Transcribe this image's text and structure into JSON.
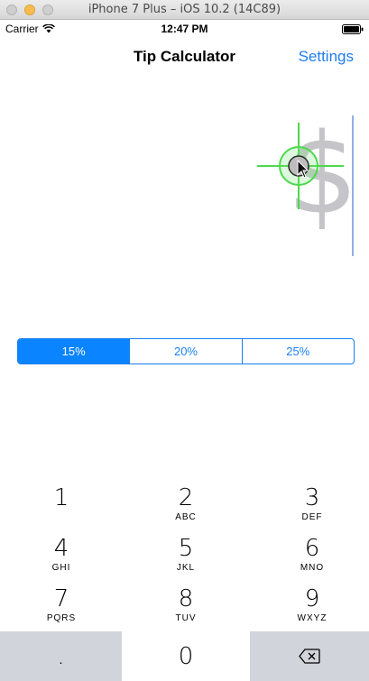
{
  "window": {
    "title": "iPhone 7 Plus – iOS 10.2 (14C89)"
  },
  "status_bar": {
    "carrier": "Carrier",
    "time": "12:47 PM"
  },
  "nav": {
    "title": "Tip Calculator",
    "settings_label": "Settings"
  },
  "bill": {
    "placeholder": "$"
  },
  "tip_segments": [
    {
      "label": "15%",
      "selected": true
    },
    {
      "label": "20%",
      "selected": false
    },
    {
      "label": "25%",
      "selected": false
    }
  ],
  "keypad": {
    "keys": [
      {
        "digit": "1",
        "letters": ""
      },
      {
        "digit": "2",
        "letters": "ABC"
      },
      {
        "digit": "3",
        "letters": "DEF"
      },
      {
        "digit": "4",
        "letters": "GHI"
      },
      {
        "digit": "5",
        "letters": "JKL"
      },
      {
        "digit": "6",
        "letters": "MNO"
      },
      {
        "digit": "7",
        "letters": "PQRS"
      },
      {
        "digit": "8",
        "letters": "TUV"
      },
      {
        "digit": "9",
        "letters": "WXYZ"
      }
    ],
    "decimal": ".",
    "zero": "0",
    "delete_icon": "delete-backward-icon"
  },
  "colors": {
    "accent": "#1a7ef0",
    "selected_segment": "#0a84ff",
    "placeholder": "#c4c4c9",
    "keypad_gray": "#d1d4da",
    "crosshair": "#4cd94c"
  }
}
